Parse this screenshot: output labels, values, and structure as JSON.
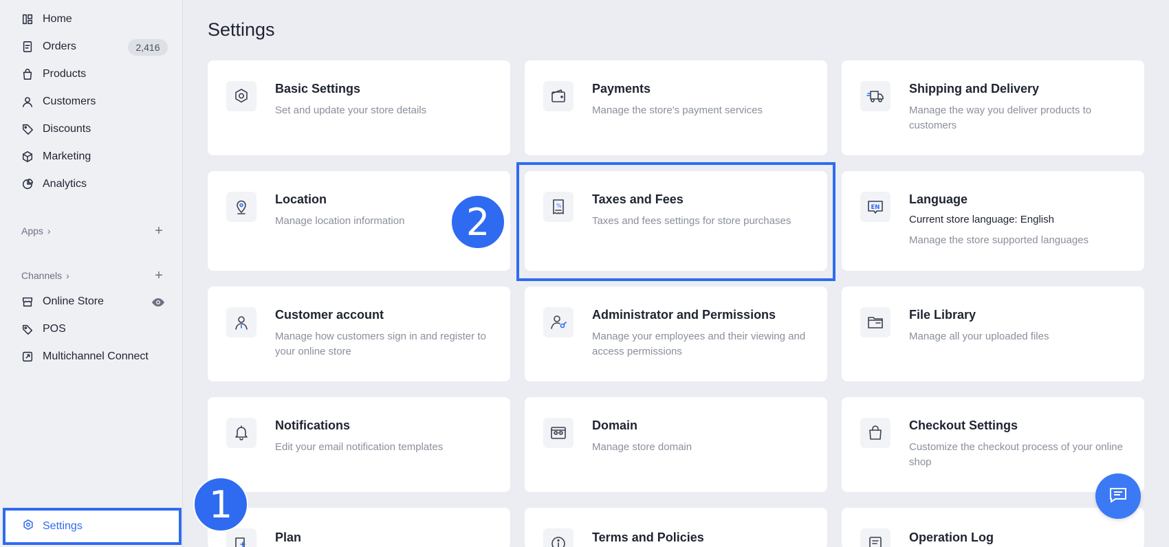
{
  "sidebar": {
    "items": [
      {
        "label": "Home",
        "icon": "home-icon"
      },
      {
        "label": "Orders",
        "icon": "orders-icon"
      },
      {
        "label": "Products",
        "icon": "products-icon"
      },
      {
        "label": "Customers",
        "icon": "customers-icon"
      },
      {
        "label": "Discounts",
        "icon": "discounts-icon"
      },
      {
        "label": "Marketing",
        "icon": "marketing-icon"
      },
      {
        "label": "Analytics",
        "icon": "analytics-icon"
      }
    ],
    "orders_badge": "2,416",
    "apps_label": "Apps",
    "channels_label": "Channels",
    "channels": [
      {
        "label": "Online Store",
        "icon": "online-store-icon"
      },
      {
        "label": "POS",
        "icon": "pos-icon"
      },
      {
        "label": "Multichannel Connect",
        "icon": "multichannel-icon"
      }
    ],
    "settings_label": "Settings"
  },
  "main": {
    "title": "Settings",
    "cards": [
      {
        "title": "Basic Settings",
        "desc": "Set and update your store details",
        "icon": "gear-icon"
      },
      {
        "title": "Payments",
        "desc": "Manage the store's payment services",
        "icon": "wallet-icon"
      },
      {
        "title": "Shipping and Delivery",
        "desc": "Manage the way you deliver products to customers",
        "icon": "truck-icon"
      },
      {
        "title": "Location",
        "desc": "Manage location information",
        "icon": "location-pin-icon"
      },
      {
        "title": "Taxes and Fees",
        "desc": "Taxes and fees settings for store purchases",
        "icon": "receipt-percent-icon"
      },
      {
        "title": "Language",
        "sub": "Current store language: English",
        "desc": "Manage the store supported languages",
        "icon": "language-en-icon"
      },
      {
        "title": "Customer account",
        "desc": "Manage how customers sign in and register to your online store",
        "icon": "user-icon"
      },
      {
        "title": "Administrator and Permissions",
        "desc": "Manage your employees and their viewing and access permissions",
        "icon": "admin-key-icon"
      },
      {
        "title": "File Library",
        "desc": "Manage all your uploaded files",
        "icon": "folder-icon"
      },
      {
        "title": "Notifications",
        "desc": "Edit your email notification templates",
        "icon": "bell-icon"
      },
      {
        "title": "Domain",
        "desc": "Manage store domain",
        "icon": "domain-link-icon"
      },
      {
        "title": "Checkout Settings",
        "desc": "Customize the checkout process of your online shop",
        "icon": "shopping-bag-icon"
      },
      {
        "title": "Plan",
        "icon": "plan-icon"
      },
      {
        "title": "Terms and Policies",
        "icon": "info-icon"
      },
      {
        "title": "Operation Log",
        "icon": "log-icon"
      }
    ]
  },
  "annotations": {
    "step1": "1",
    "step2": "2",
    "highlight_color": "#2f6bf0"
  }
}
